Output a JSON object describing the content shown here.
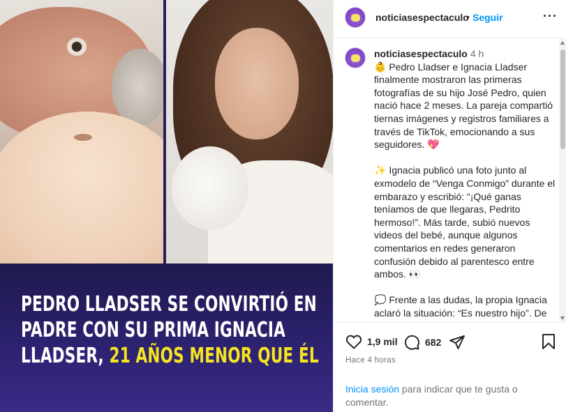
{
  "post": {
    "headline_part1": "Pedro Lladser se convirtió en padre con su prima Ignacia Lladser, ",
    "headline_part2": "21 años menor que él"
  },
  "header": {
    "username": "noticiasespectaculo",
    "separator": "•",
    "follow_label": "Seguir",
    "more_label": "···"
  },
  "caption": {
    "username": "noticiasespectaculo",
    "time": "4 h",
    "paragraph1": "👶 Pedro Lladser e Ignacia Lladser finalmente mostraron las primeras fotografías de su hijo José Pedro, quien nació hace 2 meses. La pareja compartió tiernas imágenes y registros familiares a través de TikTok, emocionando a sus seguidores. 💖",
    "paragraph2": "✨ Ignacia publicó una foto junto al exmodelo de “Venga Conmigo” durante el embarazo y escribió: “¡Qué ganas teníamos de que llegaras, Pedrito hermoso!”. Más tarde, subió nuevos videos del bebé, aunque algunos comentarios en redes generaron confusión debido al parentesco entre ambos. 👀",
    "paragraph3": "💭 Frente a las dudas, la propia Ignacia aclaró la situación: “Es nuestro hijo”. De hecho, anteriormente Pedro Lladser ya"
  },
  "actions": {
    "likes": "1,9 mil",
    "comments": "682",
    "timestamp": "Hace 4 horas"
  },
  "login": {
    "link": "Inicia sesión",
    "text": " para indicar que te gusta o comentar."
  },
  "icons": {
    "like": "heart-icon",
    "comment": "comment-bubble-icon",
    "share": "paper-plane-icon",
    "save": "bookmark-icon"
  },
  "colors": {
    "accent": "#0095f6",
    "headline_highlight": "#f7e41f",
    "banner": "#2c2270"
  }
}
